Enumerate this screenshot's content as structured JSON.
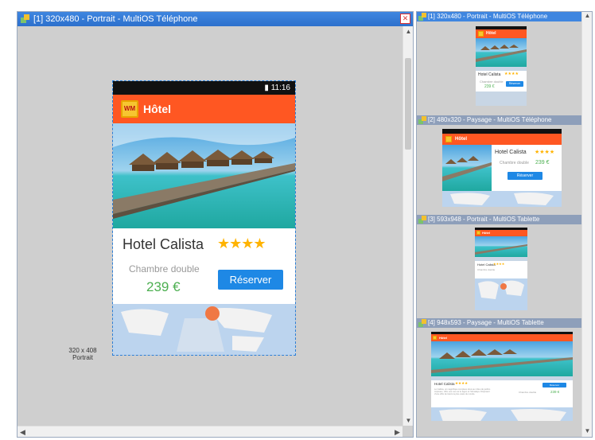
{
  "main_panel": {
    "title": "[1] 320x480 - Portrait - MultiOS Téléphone",
    "size_label_line1": "320 x 408",
    "size_label_line2": "Portrait"
  },
  "app": {
    "status_time": "11:16",
    "appbar_title": "Hôtel",
    "logo_text": "WM",
    "hotel_name": "Hotel Calista",
    "stars": "★★★★",
    "room_type": "Chambre double",
    "price": "239 €",
    "reserve_label": "Réserver",
    "description": "Le Calista, un magnifique complexe situé au milieu de jardins tropicaux, offre une vue sur le lagon et l'Himalaya. Disposant d'une offre de loisirs la plus vaste du monde."
  },
  "side_panes": [
    {
      "title": "[1] 320x480 - Portrait - MultiOS Téléphone",
      "active": true
    },
    {
      "title": "[2] 480x320 - Paysage - MultiOS Téléphone",
      "active": false
    },
    {
      "title": "[3] 593x948 - Portrait - MultiOS Tablette",
      "active": false
    },
    {
      "title": "[4] 948x593 - Paysage - MultiOS Tablette",
      "active": false
    }
  ],
  "colors": {
    "accent": "#ff5722",
    "button": "#1e88e5",
    "price": "#4caf50",
    "stars": "#ffb300",
    "titlebar": "#3f86e0"
  }
}
